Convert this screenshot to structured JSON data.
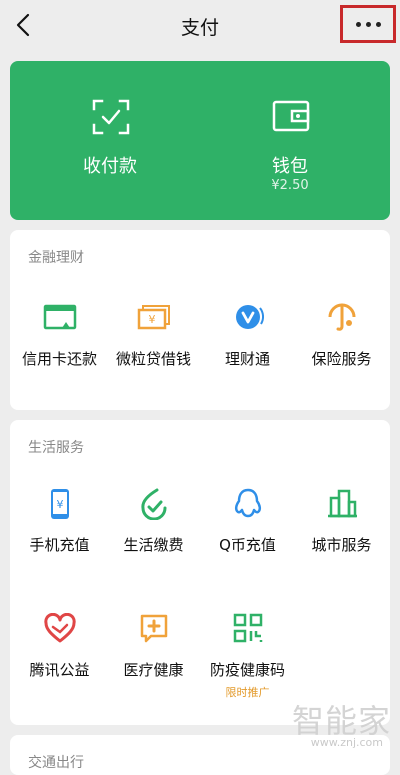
{
  "header": {
    "title": "支付",
    "back_icon": "chevron-left-icon",
    "more_icon": "more-dots-icon"
  },
  "wallet_card": {
    "bg_color": "#2fb167",
    "receive": {
      "label": "收付款",
      "icon": "scan-check-icon"
    },
    "wallet": {
      "label": "钱包",
      "balance": "¥2.50",
      "icon": "wallet-icon"
    }
  },
  "finance": {
    "title": "金融理财",
    "items": [
      {
        "label": "信用卡还款",
        "icon": "credit-card-icon"
      },
      {
        "label": "微粒贷借钱",
        "icon": "money-bill-icon"
      },
      {
        "label": "理财通",
        "icon": "wealth-icon"
      },
      {
        "label": "保险服务",
        "icon": "insurance-umbrella-icon"
      }
    ]
  },
  "life": {
    "title": "生活服务",
    "items": [
      {
        "label": "手机充值",
        "icon": "phone-topup-icon"
      },
      {
        "label": "生活缴费",
        "icon": "leaf-check-icon"
      },
      {
        "label": "Q币充值",
        "icon": "qq-penguin-icon"
      },
      {
        "label": "城市服务",
        "icon": "city-buildings-icon"
      },
      {
        "label": "腾讯公益",
        "icon": "heart-charity-icon"
      },
      {
        "label": "医疗健康",
        "icon": "medical-cross-icon"
      },
      {
        "label": "防疫健康码",
        "sub": "限时推广",
        "icon": "qr-code-icon"
      }
    ]
  },
  "next_section": {
    "title": "交通出行"
  },
  "watermark": {
    "text": "智能家",
    "url": "www.znj.com"
  }
}
